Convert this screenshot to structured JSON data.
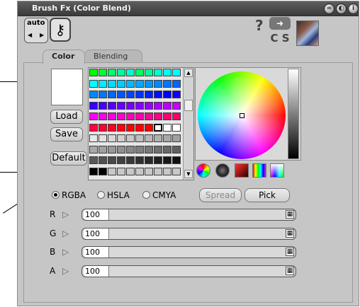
{
  "window": {
    "title": "Brush Fx (Color Blend)"
  },
  "toolbar": {
    "auto_label": "auto",
    "key_icon": "key-icon",
    "help_label": "?",
    "apply_icon": "apply-arrow-icon",
    "cs_label": "C S"
  },
  "tabs": [
    {
      "label": "Color",
      "active": true
    },
    {
      "label": "Blending",
      "active": false
    }
  ],
  "side_buttons": {
    "load": "Load",
    "save": "Save",
    "default": "Default"
  },
  "palette": {
    "rows": [
      [
        "#00ff00",
        "#00ff33",
        "#00ff66",
        "#00ff99",
        "#00ffcc",
        "#00ff66",
        "#00ff99",
        "#00ffcc",
        "#00ffee",
        "#00ffff"
      ],
      [
        "#00ffff",
        "#00eeff",
        "#00ddff",
        "#00ccff",
        "#00bbff",
        "#00aaff",
        "#0099ff",
        "#0088ff",
        "#0077ff",
        "#0066ff"
      ],
      [
        "#0088ff",
        "#0077ff",
        "#0066ff",
        "#0055ff",
        "#0044ff",
        "#0033ff",
        "#0022ff",
        "#0011ff",
        "#0000ff",
        "#1100ff"
      ],
      [
        "#3300ff",
        "#4400ff",
        "#5500ff",
        "#6600ff",
        "#7700ff",
        "#8800ff",
        "#9900ff",
        "#aa00ff",
        "#bb00ff",
        "#cc00ff"
      ],
      [
        "#ff00ff",
        "#ff00ee",
        "#ff00dd",
        "#ff00cc",
        "#ff00bb",
        "#ff00aa",
        "#ff0099",
        "#ff0088",
        "#ff0077",
        "#ff0066"
      ],
      [
        "#ff0044",
        "#ff0033",
        "#ff0022",
        "#ff0011",
        "#ff0000",
        "#ff0000",
        "#ff0000",
        "#ffffff",
        "#ffffff",
        "#ffffff"
      ],
      [
        "#e8e8e8",
        "#e0e0e0",
        "#d8d8d8",
        "#d0d0d0",
        "#c8c8c8",
        "#c0c0c0",
        "#b8b8b8",
        "#b0b0b0",
        "#a8a8a8",
        "#a0a0a0"
      ],
      [
        "#a8a8a8",
        "#a0a0a0",
        "#989898",
        "#909090",
        "#888888",
        "#808080",
        "#787878",
        "#707070",
        "#686868",
        "#606060"
      ],
      [
        "#585858",
        "#505050",
        "#484848",
        "#404040",
        "#383838",
        "#303030",
        "#282828",
        "#202020",
        "#181818",
        "#101010"
      ],
      [
        "#000000",
        "#000000",
        "#c8c8c8",
        "#c8c8c8",
        "#c8c8c8",
        "#c8c8c8",
        "#c8c8c8",
        "#c8c8c8",
        "#c8c8c8",
        "#c8c8c8"
      ]
    ],
    "selected": {
      "row": 5,
      "col": 7
    }
  },
  "mode_icons": [
    "color-wheel-icon",
    "dark-wheel-icon",
    "gradient-icon",
    "spectrum-bars-icon",
    "spectrum-grid-icon"
  ],
  "color_model": {
    "options": [
      "RGBA",
      "HSLA",
      "CMYA"
    ],
    "selected": "RGBA"
  },
  "actions": {
    "spread": "Spread",
    "pick": "Pick"
  },
  "channels": [
    {
      "letter": "R",
      "value": "100"
    },
    {
      "letter": "G",
      "value": "100"
    },
    {
      "letter": "B",
      "value": "100"
    },
    {
      "letter": "A",
      "value": "100"
    }
  ],
  "colors": {
    "title_bar": "#474747",
    "panel": "#c6c6c6",
    "current_color": "#ffffff"
  }
}
